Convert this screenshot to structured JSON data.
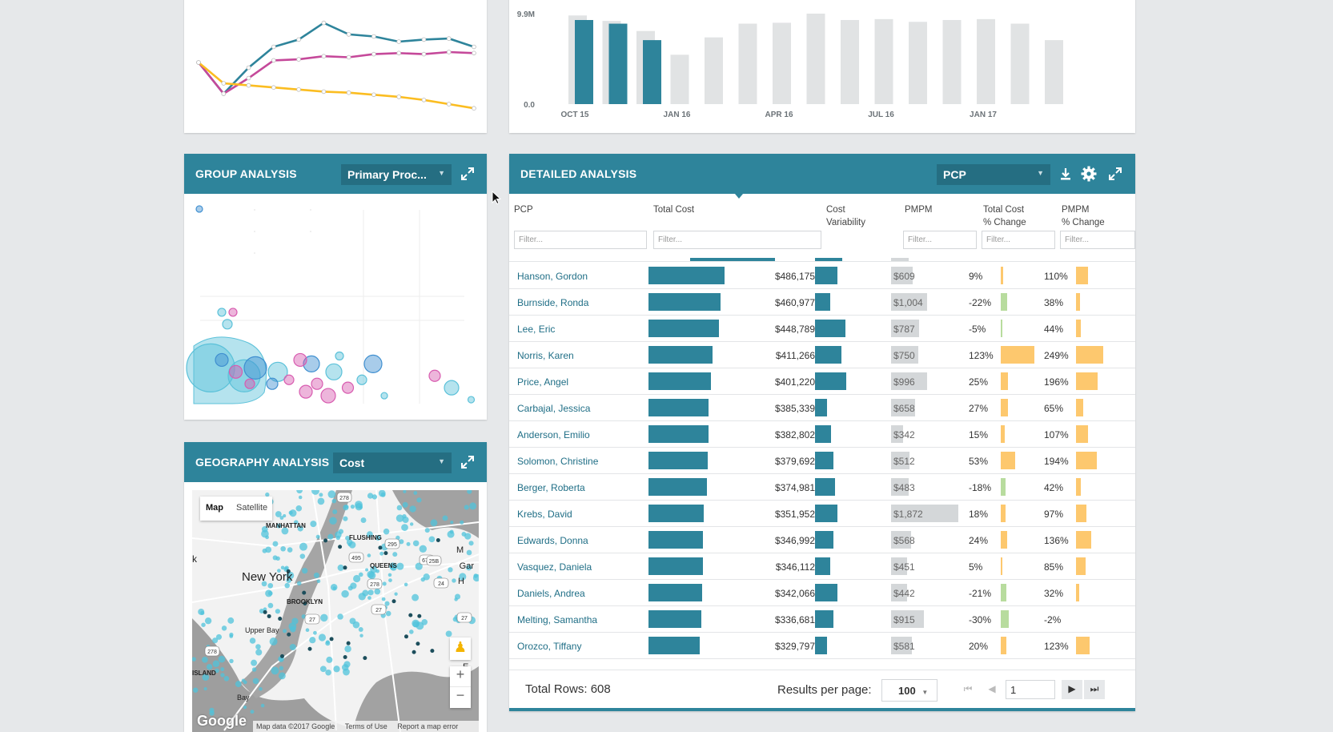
{
  "line_chart": {
    "chart_data": {
      "type": "line",
      "title": "",
      "xlabel": "",
      "ylabel": "",
      "series": [
        {
          "color": "#2e849b",
          "values": [
            40,
            10,
            35,
            55,
            62,
            78,
            67,
            65,
            60,
            62,
            63,
            55
          ]
        },
        {
          "color": "#c5499a",
          "values": [
            40,
            10,
            25,
            42,
            43,
            46,
            45,
            48,
            49,
            48,
            50,
            49
          ]
        },
        {
          "color": "#fbbd21",
          "values": [
            40,
            20,
            18,
            16,
            14,
            12,
            11,
            9,
            7,
            4,
            0,
            -4
          ]
        }
      ]
    }
  },
  "bar_chart": {
    "chart_data": {
      "type": "bar",
      "title": "",
      "xlabel": "",
      "ylabel": "",
      "ylim": [
        0,
        9.9
      ],
      "y_tick_labels": [
        "9.9M",
        "0.0"
      ],
      "x_tick_labels": [
        "OCT 15",
        "JAN 16",
        "APR 16",
        "JUL 16",
        "JAN 17"
      ],
      "series": [
        {
          "color": "#e1e3e4",
          "values": [
            9.7,
            9.1,
            8.0,
            5.4,
            7.3,
            8.8,
            8.9,
            9.9,
            9.2,
            9.3,
            9.0,
            9.2,
            9.3,
            8.8,
            7.0
          ]
        },
        {
          "color": "#2e849b",
          "values": [
            9.2,
            8.8,
            7.0,
            null,
            null,
            null,
            null,
            null,
            null,
            null,
            null,
            null,
            null,
            null,
            null
          ]
        }
      ]
    }
  },
  "group_analysis": {
    "title": "GROUP ANALYSIS",
    "dropdown_value": "Primary Proc...",
    "chart_data": {
      "type": "scatter",
      "title": "",
      "xlabel": "",
      "ylabel": "",
      "colors": {
        "teal": "#5bc1d9",
        "pink": "#d85cb0",
        "blue": "#3f8fd0"
      },
      "points": [
        {
          "x": 2,
          "y": 98,
          "r": 4,
          "c": "blue"
        },
        {
          "x": 10,
          "y": 46,
          "r": 5,
          "c": "teal"
        },
        {
          "x": 14,
          "y": 46,
          "r": 5,
          "c": "pink"
        },
        {
          "x": 12,
          "y": 40,
          "r": 6,
          "c": "teal"
        },
        {
          "x": 6,
          "y": 18,
          "r": 30,
          "c": "teal"
        },
        {
          "x": 18,
          "y": 14,
          "r": 20,
          "c": "teal"
        },
        {
          "x": 22,
          "y": 18,
          "r": 14,
          "c": "blue"
        },
        {
          "x": 30,
          "y": 16,
          "r": 12,
          "c": "teal"
        },
        {
          "x": 10,
          "y": 22,
          "r": 8,
          "c": "blue"
        },
        {
          "x": 15,
          "y": 16,
          "r": 8,
          "c": "pink"
        },
        {
          "x": 20,
          "y": 10,
          "r": 6,
          "c": "pink"
        },
        {
          "x": 28,
          "y": 10,
          "r": 7,
          "c": "blue"
        },
        {
          "x": 34,
          "y": 12,
          "r": 6,
          "c": "pink"
        },
        {
          "x": 40,
          "y": 6,
          "r": 8,
          "c": "pink"
        },
        {
          "x": 44,
          "y": 10,
          "r": 7,
          "c": "pink"
        },
        {
          "x": 42,
          "y": 20,
          "r": 10,
          "c": "blue"
        },
        {
          "x": 50,
          "y": 16,
          "r": 10,
          "c": "teal"
        },
        {
          "x": 38,
          "y": 22,
          "r": 8,
          "c": "pink"
        },
        {
          "x": 52,
          "y": 24,
          "r": 5,
          "c": "teal"
        },
        {
          "x": 48,
          "y": 4,
          "r": 9,
          "c": "pink"
        },
        {
          "x": 55,
          "y": 8,
          "r": 7,
          "c": "pink"
        },
        {
          "x": 64,
          "y": 20,
          "r": 11,
          "c": "blue"
        },
        {
          "x": 60,
          "y": 12,
          "r": 6,
          "c": "teal"
        },
        {
          "x": 68,
          "y": 4,
          "r": 4,
          "c": "teal"
        },
        {
          "x": 86,
          "y": 14,
          "r": 7,
          "c": "pink"
        },
        {
          "x": 92,
          "y": 8,
          "r": 9,
          "c": "teal"
        },
        {
          "x": 99,
          "y": 2,
          "r": 4,
          "c": "teal"
        }
      ]
    }
  },
  "geography_analysis": {
    "title": "GEOGRAPHY ANALYSIS",
    "dropdown_value": "Cost",
    "map": {
      "tab_map": "Map",
      "tab_satellite": "Satellite",
      "city_label": "New York",
      "labels": [
        "MANHATTAN",
        "FLUSHING",
        "QUEENS",
        "BROOKLYN",
        "Upper Bay",
        "ISLAND",
        "Bay",
        "k",
        "M",
        "Gar",
        "H",
        "E"
      ],
      "route_shields": [
        "278",
        "295",
        "495",
        "678",
        "278",
        "27",
        "27",
        "24",
        "25B",
        "278",
        "27"
      ],
      "zoom_in": "+",
      "zoom_out": "−",
      "logo": "Google",
      "attribution": "Map data ©2017 Google",
      "terms": "Terms of Use",
      "report": "Report a map error"
    }
  },
  "detailed_analysis": {
    "title": "DETAILED ANALYSIS",
    "dropdown_value": "PCP",
    "columns": {
      "pcp": "PCP",
      "total_cost": "Total Cost",
      "cost_var_1": "Cost",
      "cost_var_2": "Variability",
      "pmpm": "PMPM",
      "tc_change_1": "Total Cost",
      "tc_change_2": "% Change",
      "pmpm_change_1": "PMPM",
      "pmpm_change_2": "% Change"
    },
    "filter_placeholder": "Filter...",
    "colors": {
      "teal": "#2e849b",
      "grey": "#d4d7d9",
      "orange": "#fdc86e",
      "green": "#b8dc9e"
    },
    "rows": [
      {
        "name": "Hanson, Gordon",
        "cost": "$486,175",
        "cost_v": 486175,
        "var": 0.55,
        "pmpm": "$609",
        "pmpm_v": 609,
        "tc": "9%",
        "tc_v": 9,
        "pc": "110%",
        "pc_v": 110
      },
      {
        "name": "Burnside, Ronda",
        "cost": "$460,977",
        "cost_v": 460977,
        "var": 0.38,
        "pmpm": "$1,004",
        "pmpm_v": 1004,
        "tc": "-22%",
        "tc_v": -22,
        "pc": "38%",
        "pc_v": 38
      },
      {
        "name": "Lee, Eric",
        "cost": "$448,789",
        "cost_v": 448789,
        "var": 0.75,
        "pmpm": "$787",
        "pmpm_v": 787,
        "tc": "-5%",
        "tc_v": -5,
        "pc": "44%",
        "pc_v": 44
      },
      {
        "name": "Norris, Karen",
        "cost": "$411,266",
        "cost_v": 411266,
        "var": 0.65,
        "pmpm": "$750",
        "pmpm_v": 750,
        "tc": "123%",
        "tc_v": 123,
        "pc": "249%",
        "pc_v": 249
      },
      {
        "name": "Price, Angel",
        "cost": "$401,220",
        "cost_v": 401220,
        "var": 0.78,
        "pmpm": "$996",
        "pmpm_v": 996,
        "tc": "25%",
        "tc_v": 25,
        "pc": "196%",
        "pc_v": 196
      },
      {
        "name": "Carbajal, Jessica",
        "cost": "$385,339",
        "cost_v": 385339,
        "var": 0.3,
        "pmpm": "$658",
        "pmpm_v": 658,
        "tc": "27%",
        "tc_v": 27,
        "pc": "65%",
        "pc_v": 65
      },
      {
        "name": "Anderson, Emilio",
        "cost": "$382,802",
        "cost_v": 382802,
        "var": 0.4,
        "pmpm": "$342",
        "pmpm_v": 342,
        "tc": "15%",
        "tc_v": 15,
        "pc": "107%",
        "pc_v": 107
      },
      {
        "name": "Solomon, Christine",
        "cost": "$379,692",
        "cost_v": 379692,
        "var": 0.45,
        "pmpm": "$512",
        "pmpm_v": 512,
        "tc": "53%",
        "tc_v": 53,
        "pc": "194%",
        "pc_v": 194
      },
      {
        "name": "Berger, Roberta",
        "cost": "$374,981",
        "cost_v": 374981,
        "var": 0.5,
        "pmpm": "$483",
        "pmpm_v": 483,
        "tc": "-18%",
        "tc_v": -18,
        "pc": "42%",
        "pc_v": 42
      },
      {
        "name": "Krebs, David",
        "cost": "$351,952",
        "cost_v": 351952,
        "var": 0.56,
        "pmpm": "$1,872",
        "pmpm_v": 1872,
        "tc": "18%",
        "tc_v": 18,
        "pc": "97%",
        "pc_v": 97
      },
      {
        "name": "Edwards, Donna",
        "cost": "$346,992",
        "cost_v": 346992,
        "var": 0.45,
        "pmpm": "$568",
        "pmpm_v": 568,
        "tc": "24%",
        "tc_v": 24,
        "pc": "136%",
        "pc_v": 136
      },
      {
        "name": "Vasquez, Daniela",
        "cost": "$346,112",
        "cost_v": 346112,
        "var": 0.38,
        "pmpm": "$451",
        "pmpm_v": 451,
        "tc": "5%",
        "tc_v": 5,
        "pc": "85%",
        "pc_v": 85
      },
      {
        "name": "Daniels, Andrea",
        "cost": "$342,066",
        "cost_v": 342066,
        "var": 0.55,
        "pmpm": "$442",
        "pmpm_v": 442,
        "tc": "-21%",
        "tc_v": -21,
        "pc": "32%",
        "pc_v": 32
      },
      {
        "name": "Melting, Samantha",
        "cost": "$336,681",
        "cost_v": 336681,
        "var": 0.45,
        "pmpm": "$915",
        "pmpm_v": 915,
        "tc": "-30%",
        "tc_v": -30,
        "pc": "-2%",
        "pc_v": -2
      },
      {
        "name": "Orozco, Tiffany",
        "cost": "$329,797",
        "cost_v": 329797,
        "var": 0.3,
        "pmpm": "$581",
        "pmpm_v": 581,
        "tc": "20%",
        "tc_v": 20,
        "pc": "123%",
        "pc_v": 123
      }
    ],
    "footer": {
      "total_rows": "Total Rows: 608",
      "results_label": "Results per page:",
      "per_page": "100",
      "page": "1"
    }
  }
}
